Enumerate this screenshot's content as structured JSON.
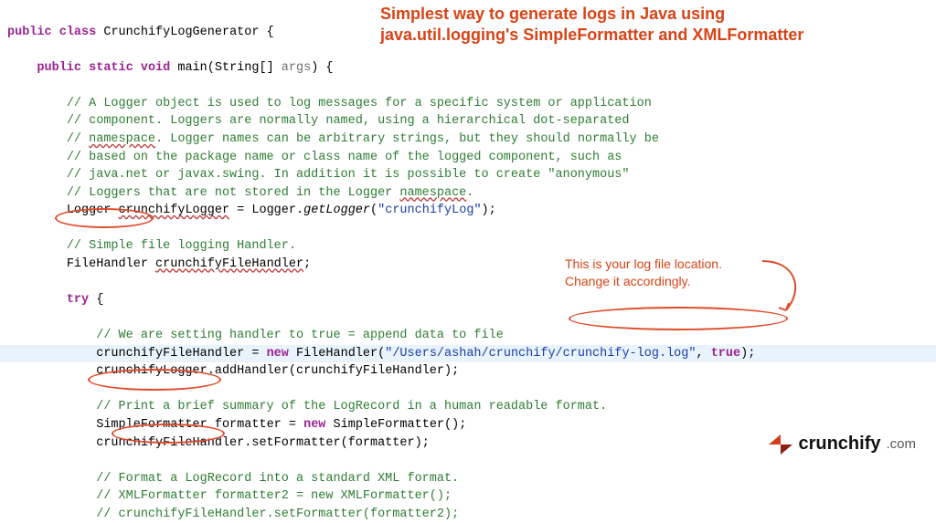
{
  "annotations": {
    "title_line1": "Simplest way to generate logs in Java using",
    "title_line2": "java.util.logging's SimpleFormatter and XMLFormatter",
    "side_line1": "This is your log file location.",
    "side_line2": "Change it accordingly."
  },
  "logo": {
    "brand": "crunchify",
    "suffix": ".com"
  },
  "code": {
    "l01_kw1": "public",
    "l01_kw2": "class",
    "l01_name": "CrunchifyLogGenerator",
    "l02_kw1": "public",
    "l02_kw2": "static",
    "l02_kw3": "void",
    "l02_name": "main",
    "l02_arr": "String[]",
    "l02_param": "args",
    "c01": "// A Logger object is used to log messages for a specific system or application",
    "c02": "// component. Loggers are normally named, using a hierarchical dot-separated",
    "c03_a": "// ",
    "c03_b": "namespace",
    "c03_c": ". Logger names can be arbitrary strings, but they should normally be",
    "c04": "// based on the package name or class name of the logged component, such as",
    "c05": "// java.net or javax.swing. In addition it is possible to create \"anonymous\"",
    "c06_a": "// Loggers that are not stored in the Logger ",
    "c06_b": "namespace",
    "c06_c": ".",
    "l07_type": "Logger",
    "l07_var": "crunchifyLogger",
    "l07_eq": " = ",
    "l07_cls": "Logger",
    "l07_call": "getLogger",
    "l07_str": "\"crunchifyLog\"",
    "c08": "// Simple file logging Handler.",
    "l09_type": "FileHandler",
    "l09_var": "crunchifyFileHandler",
    "l10_kw": "try",
    "c11": "// We are setting handler to true = append data to file",
    "l12_var": "crunchifyFileHandler",
    "l12_kw": "new",
    "l12_type": "FileHandler",
    "l12_str": "\"/Users/ashah/crunchify/crunchify-log.log\"",
    "l12_bool": "true",
    "l13_a": "crunchifyLogger",
    "l13_b": "addHandler",
    "l13_c": "crunchifyFileHandler",
    "c14": "// Print a brief summary of the LogRecord in a human readable format.",
    "l15_type": "SimpleFormatter",
    "l15_var": "formatter",
    "l15_kw": "new",
    "l15_type2": "SimpleFormatter",
    "l16_a": "crunchifyFileHandler",
    "l16_b": "setFormatter",
    "l16_c": "formatter",
    "c17": "// Format a LogRecord into a standard XML format.",
    "c18": "// XMLFormatter formatter2 = new XMLFormatter();",
    "c19": "// crunchifyFileHandler.setFormatter(formatter2);"
  }
}
